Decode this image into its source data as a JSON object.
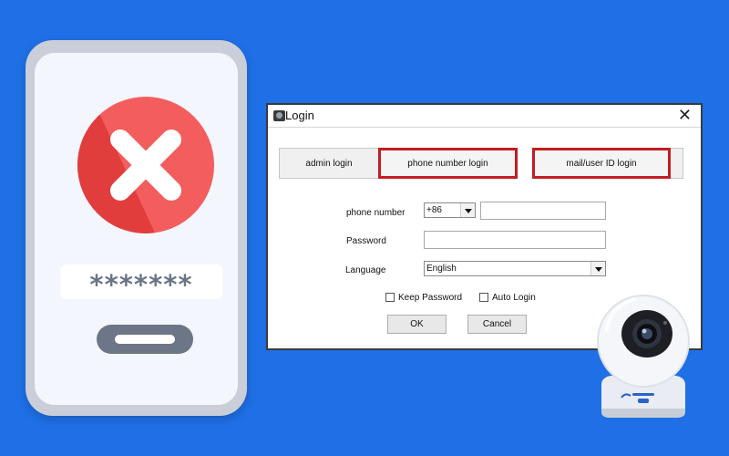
{
  "phone": {
    "masked_password": "*******",
    "icons": [
      "error-x-icon"
    ]
  },
  "dialog": {
    "title": "Login",
    "close_glyph": "✕",
    "tabs": [
      {
        "label": "admin login",
        "highlighted": false
      },
      {
        "label": "phone number login",
        "highlighted": true
      },
      {
        "label": "mail/user ID login",
        "highlighted": true
      }
    ],
    "phone_number_label": "phone number",
    "country_code": "+86",
    "phone_number_value": "",
    "password_label": "Password",
    "password_value": "",
    "language_label": "Language",
    "language_value": "English",
    "keep_password_label": "Keep Password",
    "keep_password_checked": false,
    "auto_login_label": "Auto Login",
    "auto_login_checked": false,
    "ok_label": "OK",
    "cancel_label": "Cancel"
  },
  "colors": {
    "background": "#1f6fe6",
    "error_red": "#f35d5d",
    "highlight_red": "#c21d22"
  }
}
